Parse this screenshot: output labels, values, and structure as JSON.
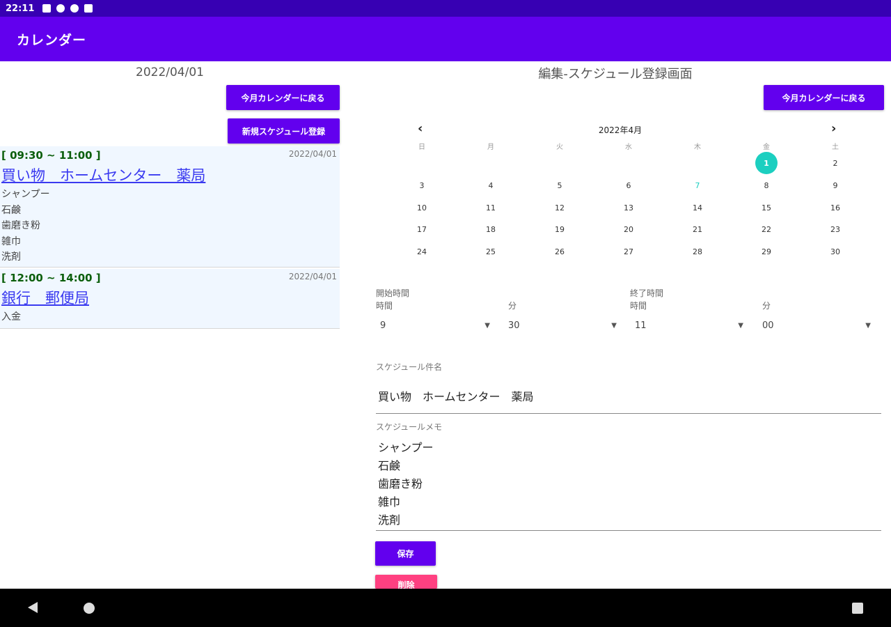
{
  "status_bar": {
    "time": "22:11"
  },
  "app_bar": {
    "title": "カレンダー"
  },
  "left_panel": {
    "date": "2022/04/01",
    "back_to_month_label": "今月カレンダーに戻る",
    "new_schedule_label": "新規スケジュール登録",
    "schedules": [
      {
        "time": "[ 09:30 ~ 11:00 ]",
        "date": "2022/04/01",
        "title": "買い物　ホームセンター　薬局",
        "memo": [
          "シャンプー",
          "石鹸",
          "歯磨き粉",
          "雑巾",
          "洗剤"
        ]
      },
      {
        "time": "[ 12:00 ~ 14:00 ]",
        "date": "2022/04/01",
        "title": "銀行　郵便局",
        "memo": [
          "入金"
        ]
      }
    ]
  },
  "right_panel": {
    "heading": "編集-スケジュール登録画面",
    "back_to_month_label": "今月カレンダーに戻る",
    "calendar": {
      "month_label": "2022年4月",
      "weekdays": [
        "日",
        "月",
        "火",
        "水",
        "木",
        "金",
        "土"
      ],
      "weeks": [
        [
          "",
          "",
          "",
          "",
          "",
          "1",
          "2"
        ],
        [
          "3",
          "4",
          "5",
          "6",
          "7",
          "8",
          "9"
        ],
        [
          "10",
          "11",
          "12",
          "13",
          "14",
          "15",
          "16"
        ],
        [
          "17",
          "18",
          "19",
          "20",
          "21",
          "22",
          "23"
        ],
        [
          "24",
          "25",
          "26",
          "27",
          "28",
          "29",
          "30"
        ]
      ],
      "selected_day": "1",
      "today_day": "7"
    },
    "start_label": "開始時間",
    "end_label": "終了時間",
    "hour_label": "時間",
    "minute_label": "分",
    "start_hour": "9",
    "start_minute": "30",
    "end_hour": "11",
    "end_minute": "00",
    "name_label": "スケジュール件名",
    "name_value": "買い物　ホームセンター　薬局",
    "memo_label": "スケジュールメモ",
    "memo_lines": [
      "シャンプー",
      "石鹸",
      "歯磨き粉",
      "雑巾",
      "洗剤"
    ],
    "save_label": "保存",
    "delete_label": "削除"
  },
  "colors": {
    "status_bar": "#3700b3",
    "app_bar": "#6200ee",
    "button": "#6200ee",
    "delete_button": "#ff4081",
    "selected_day": "#1ccfc0",
    "card_background": "#f0f7ff",
    "time_text": "#0b5e0b",
    "title_link": "#3a3af0"
  }
}
